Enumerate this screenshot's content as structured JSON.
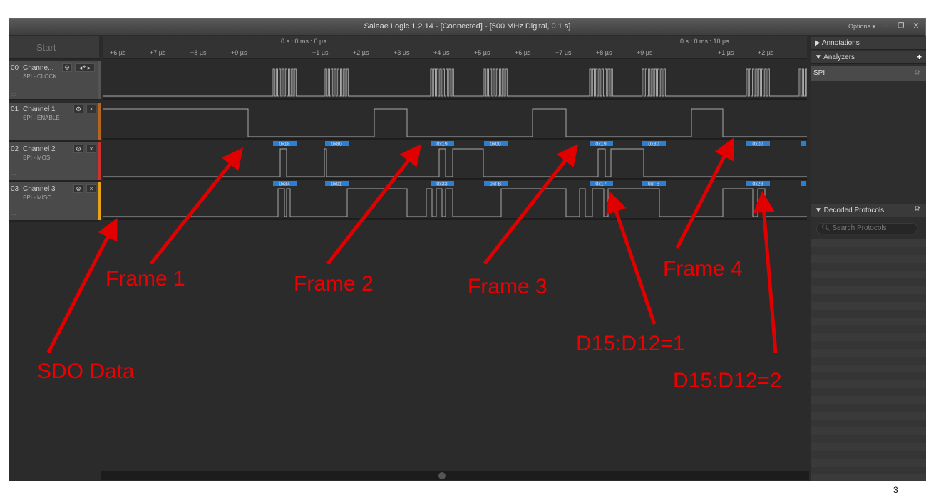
{
  "window": {
    "title": "Saleae Logic 1.2.14 - [Connected] - [500 MHz Digital, 0.1 s]",
    "options_label": "Options ▾",
    "minimize": "–",
    "restore": "❐",
    "close": "X"
  },
  "start_label": "Start",
  "ruler": {
    "abs_labels": [
      "0 s : 0 ms : 0 µs",
      "0 s : 0 ms : 10 µs"
    ],
    "ticks": [
      "+6 µs",
      "+7 µs",
      "+8 µs",
      "+9 µs",
      "+1 µs",
      "+2 µs",
      "+3 µs",
      "+4 µs",
      "+5 µs",
      "+6 µs",
      "+7 µs",
      "+8 µs",
      "+9 µs",
      "+1 µs",
      "+2 µs"
    ]
  },
  "channels": [
    {
      "num": "00",
      "name": "Channe...",
      "sub": "SPI - CLOCK",
      "color": "#555555"
    },
    {
      "num": "01",
      "name": "Channel 1",
      "sub": "SPI - ENABLE",
      "color": "#b5651d"
    },
    {
      "num": "02",
      "name": "Channel 2",
      "sub": "SPI - MOSI",
      "color": "#d0312d"
    },
    {
      "num": "03",
      "name": "Channel 3",
      "sub": "SPI - MISO",
      "color": "#e8a317"
    }
  ],
  "decoded": {
    "mosi": [
      "0x18",
      "0x80",
      "0x19",
      "0x00",
      "0x19",
      "0x80",
      "0x00"
    ],
    "miso": [
      "0x34",
      "0x01",
      "0x33",
      "0xFB",
      "0x17",
      "0xFB",
      "0x23"
    ],
    "label_color": "#2a7fd4"
  },
  "right_panel": {
    "annotations": "▶ Annotations",
    "analyzers": "▼ Analyzers",
    "analyzer_item": "SPI",
    "decoded_protocols": "▼ Decoded Protocols",
    "search_placeholder": "Search Protocols"
  },
  "annotations": {
    "sdo": "SDO Data",
    "frame1": "Frame 1",
    "frame2": "Frame 2",
    "frame3": "Frame 3",
    "frame4": "Frame 4",
    "d1": "D15:D12=1",
    "d2": "D15:D12=2",
    "color": "#e00000"
  },
  "page_number": "3"
}
